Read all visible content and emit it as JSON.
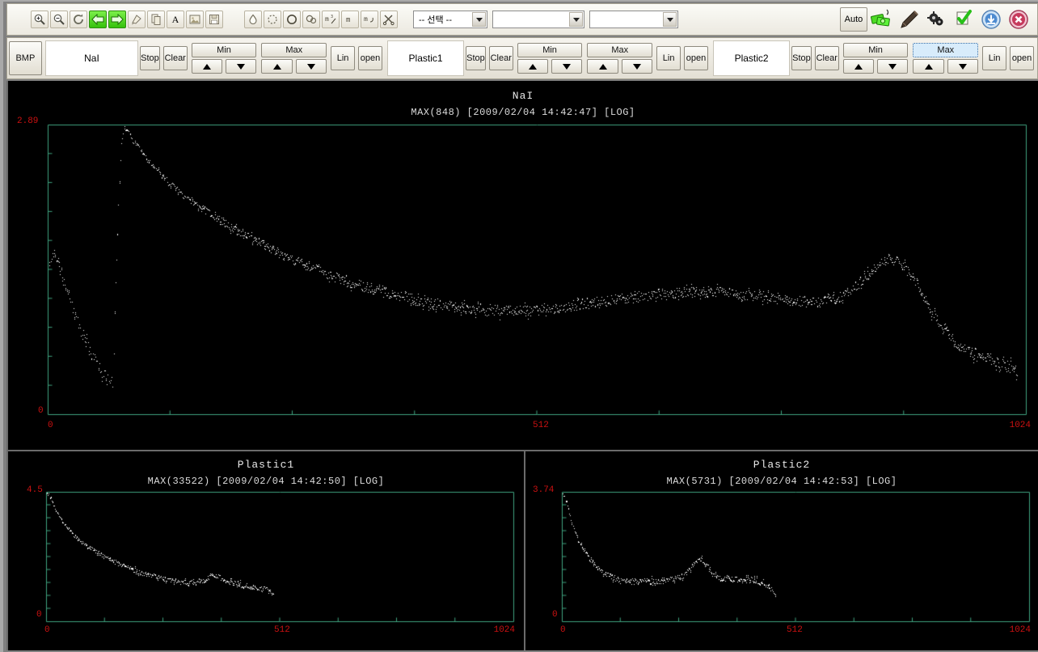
{
  "toolbar": {
    "left_icons": [
      {
        "name": "zoom-in-icon",
        "label": "Zoom In"
      },
      {
        "name": "zoom-out-icon",
        "label": "Zoom Out"
      },
      {
        "name": "refresh-icon",
        "label": "Refresh"
      },
      {
        "name": "arrow-left-icon",
        "label": "Back"
      },
      {
        "name": "arrow-right-icon",
        "label": "Forward"
      },
      {
        "name": "paint-icon",
        "label": "Paint"
      },
      {
        "name": "copy-icon",
        "label": "Copy"
      },
      {
        "name": "text-icon",
        "label": "A"
      },
      {
        "name": "image-icon",
        "label": "Image"
      },
      {
        "name": "save-icon",
        "label": "Save"
      }
    ],
    "shape_icons": [
      {
        "name": "drop-icon",
        "label": "Drop"
      },
      {
        "name": "dashed-circle-icon",
        "label": "Dashed Circle"
      },
      {
        "name": "circle-icon",
        "label": "Circle"
      },
      {
        "name": "double-circle-icon",
        "label": "Double Circle"
      },
      {
        "name": "m3-measure-icon",
        "label": "m3"
      },
      {
        "name": "m-measure-icon",
        "label": "m"
      },
      {
        "name": "m-curve-icon",
        "label": "m curve"
      },
      {
        "name": "scissors-icon",
        "label": "Cut"
      }
    ],
    "combos": [
      {
        "name": "select-combo",
        "value": "-- 선택 --"
      },
      {
        "name": "second-combo",
        "value": ""
      },
      {
        "name": "third-combo",
        "value": ""
      }
    ],
    "auto_label": "Auto",
    "right_icons": [
      {
        "name": "money-icon",
        "label": "Money"
      },
      {
        "name": "pen-tool-icon",
        "label": "Pen"
      },
      {
        "name": "gears-icon",
        "label": "Gears"
      },
      {
        "name": "check-clipboard-icon",
        "label": "Validate"
      },
      {
        "name": "download-icon",
        "label": "Download"
      },
      {
        "name": "close-icon",
        "label": "Close"
      }
    ]
  },
  "control_bar": {
    "bmp_label": "BMP",
    "panels": [
      {
        "name": "NaI",
        "stop_label": "Stop",
        "clear_label": "Clear",
        "min_label": "Min",
        "max_label": "Max",
        "lin_label": "Lin",
        "open_label": "open",
        "max_focused": false
      },
      {
        "name": "Plastic1",
        "stop_label": "Stop",
        "clear_label": "Clear",
        "min_label": "Min",
        "max_label": "Max",
        "lin_label": "Lin",
        "open_label": "open",
        "max_focused": false
      },
      {
        "name": "Plastic2",
        "stop_label": "Stop",
        "clear_label": "Clear",
        "min_label": "Min",
        "max_label": "Max",
        "lin_label": "Lin",
        "open_label": "open",
        "max_focused": true
      }
    ]
  },
  "chart_data": [
    {
      "id": "nai",
      "type": "scatter",
      "title": "NaI",
      "subtitle": "MAX(848)  [2009/02/04 14:42:47] [LOG]",
      "max_counts": 848,
      "timestamp": "2009/02/04 14:42:47",
      "scale": "LOG",
      "xlabel": "",
      "ylabel": "",
      "xlim": [
        0,
        1024
      ],
      "ylim": [
        0,
        2.89
      ],
      "xticks": [
        "0",
        "512",
        "1024"
      ],
      "yticks": [
        "0",
        "2.89"
      ],
      "grid": false,
      "point_color": "#ffffff",
      "axis_color": "#3fa37f",
      "tick_label_color": "#cc1111",
      "background": "#000000",
      "x": [
        2,
        5,
        8,
        11,
        14,
        17,
        20,
        23,
        26,
        29,
        32,
        35,
        38,
        41,
        44,
        47,
        50,
        53,
        56,
        59,
        62,
        65,
        68,
        71,
        74,
        77,
        80,
        83,
        86,
        89,
        92,
        95,
        98,
        101,
        104,
        107,
        110,
        113,
        116,
        119,
        122,
        125,
        128,
        134,
        140,
        146,
        152,
        158,
        164,
        170,
        176,
        182,
        188,
        194,
        200,
        206,
        212,
        218,
        224,
        230,
        236,
        242,
        248,
        254,
        260,
        266,
        272,
        278,
        284,
        290,
        296,
        302,
        308,
        314,
        320,
        326,
        332,
        338,
        344,
        350,
        356,
        362,
        368,
        374,
        380,
        386,
        392,
        398,
        404,
        410,
        416,
        422,
        428,
        434,
        440,
        446,
        452,
        458,
        464,
        470,
        476,
        482,
        488,
        494,
        500,
        506,
        512,
        520,
        528,
        536,
        544,
        552,
        560,
        568,
        576,
        584,
        592,
        600,
        608,
        616,
        624,
        632,
        640,
        648,
        656,
        664,
        672,
        680,
        688,
        696,
        704,
        712,
        720,
        728,
        736,
        744,
        752,
        760,
        768,
        776,
        784,
        792,
        800,
        808,
        816,
        824,
        832,
        840,
        848,
        856,
        864,
        872,
        880,
        888,
        896,
        904,
        912,
        920,
        928,
        936,
        944,
        952,
        960,
        968,
        976,
        984,
        992,
        1000,
        1008,
        1016,
        1022
      ],
      "y": [
        1.52,
        1.63,
        1.58,
        1.49,
        1.4,
        1.3,
        1.22,
        1.14,
        1.05,
        0.98,
        0.9,
        0.83,
        0.76,
        0.7,
        0.63,
        0.58,
        0.52,
        0.48,
        0.44,
        0.4,
        0.36,
        0.33,
        0.3,
        1.3,
        2.1,
        2.72,
        2.86,
        2.84,
        2.79,
        2.74,
        2.7,
        2.66,
        2.62,
        2.58,
        2.55,
        2.51,
        2.48,
        2.45,
        2.42,
        2.39,
        2.36,
        2.33,
        2.3,
        2.25,
        2.2,
        2.16,
        2.12,
        2.08,
        2.04,
        2.0,
        1.96,
        1.93,
        1.89,
        1.86,
        1.82,
        1.79,
        1.76,
        1.73,
        1.7,
        1.67,
        1.64,
        1.61,
        1.58,
        1.56,
        1.53,
        1.51,
        1.48,
        1.46,
        1.44,
        1.41,
        1.39,
        1.37,
        1.35,
        1.33,
        1.31,
        1.29,
        1.27,
        1.26,
        1.24,
        1.22,
        1.21,
        1.19,
        1.18,
        1.17,
        1.15,
        1.14,
        1.13,
        1.12,
        1.11,
        1.1,
        1.09,
        1.08,
        1.07,
        1.06,
        1.06,
        1.05,
        1.05,
        1.04,
        1.04,
        1.04,
        1.03,
        1.03,
        1.03,
        1.03,
        1.03,
        1.04,
        1.04,
        1.05,
        1.06,
        1.07,
        1.08,
        1.09,
        1.1,
        1.11,
        1.12,
        1.13,
        1.14,
        1.15,
        1.16,
        1.17,
        1.18,
        1.19,
        1.2,
        1.2,
        1.21,
        1.21,
        1.22,
        1.22,
        1.22,
        1.22,
        1.22,
        1.21,
        1.21,
        1.2,
        1.19,
        1.18,
        1.17,
        1.16,
        1.15,
        1.14,
        1.13,
        1.12,
        1.12,
        1.12,
        1.13,
        1.15,
        1.18,
        1.23,
        1.3,
        1.38,
        1.46,
        1.52,
        1.55,
        1.54,
        1.48,
        1.38,
        1.26,
        1.12,
        0.98,
        0.86,
        0.77,
        0.7,
        0.65,
        0.61,
        0.58,
        0.55,
        0.52,
        0.5,
        0.47,
        0.44
      ]
    },
    {
      "id": "plastic1",
      "type": "scatter",
      "title": "Plastic1",
      "subtitle": "MAX(33522)  [2009/02/04 14:42:50] [LOG]",
      "max_counts": 33522,
      "timestamp": "2009/02/04 14:42:50",
      "scale": "LOG",
      "xlabel": "",
      "ylabel": "",
      "xlim": [
        0,
        1024
      ],
      "ylim": [
        0,
        4.5
      ],
      "xticks": [
        "0",
        "512",
        "1024"
      ],
      "yticks": [
        "0",
        "4.5"
      ],
      "grid": false,
      "point_color": "#ffffff",
      "axis_color": "#3fa37f",
      "tick_label_color": "#cc1111",
      "background": "#000000",
      "x": [
        2,
        6,
        10,
        14,
        18,
        22,
        26,
        30,
        34,
        38,
        42,
        46,
        50,
        56,
        62,
        68,
        74,
        80,
        86,
        92,
        98,
        104,
        110,
        116,
        122,
        128,
        136,
        144,
        152,
        160,
        168,
        176,
        184,
        192,
        200,
        208,
        216,
        224,
        232,
        240,
        248,
        256,
        264,
        272,
        280,
        288,
        296,
        304,
        312,
        320,
        328,
        336,
        344,
        352,
        360,
        368,
        376,
        384,
        392,
        400,
        408,
        416,
        424,
        432,
        440,
        448,
        456,
        464,
        472,
        480,
        488,
        496,
        500
      ],
      "y": [
        4.48,
        4.4,
        4.26,
        4.12,
        3.98,
        3.85,
        3.73,
        3.62,
        3.52,
        3.43,
        3.34,
        3.26,
        3.18,
        3.08,
        2.99,
        2.9,
        2.82,
        2.74,
        2.67,
        2.6,
        2.54,
        2.48,
        2.42,
        2.36,
        2.31,
        2.26,
        2.19,
        2.12,
        2.06,
        2.0,
        1.94,
        1.89,
        1.84,
        1.79,
        1.74,
        1.7,
        1.66,
        1.62,
        1.58,
        1.55,
        1.51,
        1.48,
        1.45,
        1.43,
        1.41,
        1.39,
        1.37,
        1.36,
        1.35,
        1.35,
        1.36,
        1.38,
        1.42,
        1.48,
        1.55,
        1.6,
        1.57,
        1.5,
        1.43,
        1.38,
        1.33,
        1.3,
        1.28,
        1.26,
        1.24,
        1.22,
        1.2,
        1.17,
        1.14,
        1.1,
        1.05,
        0.96,
        0.8
      ]
    },
    {
      "id": "plastic2",
      "type": "scatter",
      "title": "Plastic2",
      "subtitle": "MAX(5731)  [2009/02/04 14:42:53] [LOG]",
      "max_counts": 5731,
      "timestamp": "2009/02/04 14:42:53",
      "scale": "LOG",
      "xlabel": "",
      "ylabel": "",
      "xlim": [
        0,
        1024
      ],
      "ylim": [
        0,
        3.74
      ],
      "xticks": [
        "0",
        "512",
        "1024"
      ],
      "yticks": [
        "0",
        "3.74"
      ],
      "grid": false,
      "point_color": "#ffffff",
      "axis_color": "#3fa37f",
      "tick_label_color": "#cc1111",
      "background": "#000000",
      "x": [
        2,
        6,
        10,
        14,
        18,
        22,
        26,
        30,
        34,
        38,
        42,
        46,
        50,
        56,
        62,
        68,
        74,
        80,
        86,
        92,
        98,
        104,
        112,
        120,
        128,
        136,
        144,
        152,
        160,
        168,
        176,
        184,
        192,
        200,
        208,
        216,
        224,
        232,
        240,
        248,
        256,
        264,
        272,
        280,
        288,
        296,
        304,
        312,
        320,
        328,
        336,
        344,
        352,
        360,
        368,
        376,
        384,
        392,
        400,
        408,
        416,
        424,
        432,
        440,
        448,
        456,
        464,
        470
      ],
      "y": [
        3.72,
        3.6,
        3.42,
        3.22,
        3.02,
        2.84,
        2.68,
        2.54,
        2.41,
        2.3,
        2.2,
        2.1,
        2.01,
        1.9,
        1.8,
        1.71,
        1.62,
        1.54,
        1.47,
        1.41,
        1.36,
        1.32,
        1.26,
        1.22,
        1.19,
        1.17,
        1.16,
        1.15,
        1.15,
        1.15,
        1.15,
        1.16,
        1.16,
        1.17,
        1.17,
        1.18,
        1.18,
        1.19,
        1.2,
        1.22,
        1.25,
        1.3,
        1.38,
        1.5,
        1.64,
        1.76,
        1.8,
        1.72,
        1.56,
        1.4,
        1.3,
        1.26,
        1.24,
        1.23,
        1.22,
        1.22,
        1.22,
        1.22,
        1.21,
        1.2,
        1.19,
        1.18,
        1.16,
        1.13,
        1.08,
        1.0,
        0.88,
        0.7
      ]
    }
  ]
}
